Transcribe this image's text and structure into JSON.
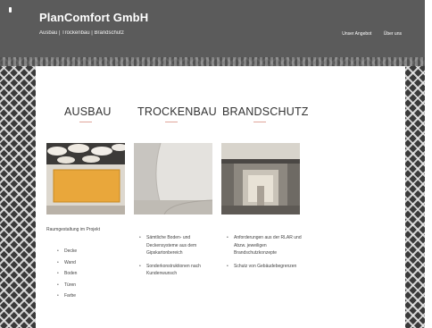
{
  "header": {
    "title": "PlanComfort GmbH",
    "subtitle": "Ausbau | Trockenbau | Brandschutz",
    "nav": [
      "Unser Angebot",
      "Über uns"
    ]
  },
  "columns": [
    {
      "heading": "AUSBAU",
      "intro": "Raumgestaltung im Projekt",
      "items": [
        "Decke",
        "Wand",
        "Boden",
        "Türen",
        "Farbe"
      ]
    },
    {
      "heading": "TROCKENBAU",
      "items": [
        "Sämtliche Boden- und Deckensysteme aus dem Gipskartonbereich",
        "Sonderkonstruktionen nach Kundenwunsch"
      ]
    },
    {
      "heading": "BRANDSCHUTZ",
      "items": [
        "Anforderungen aus der RLAR und Abzw. jeweiligen Brandschutzkonzepte",
        "Schutz von Gebäudebegrenzen"
      ]
    }
  ]
}
